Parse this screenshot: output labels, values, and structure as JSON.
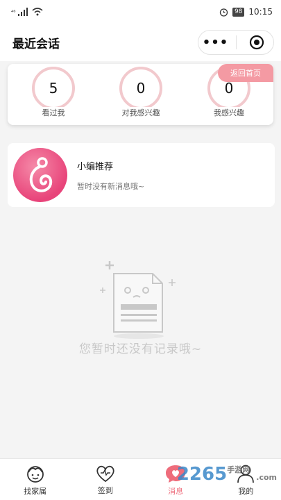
{
  "status_bar": {
    "signal_text": "⁴⁶",
    "time": "10:15",
    "battery": "98"
  },
  "nav": {
    "title": "最近会话",
    "more_icon": "more-dots-icon",
    "close_icon": "target-circle-icon"
  },
  "stats": {
    "items": [
      {
        "count": "5",
        "label": "看过我"
      },
      {
        "count": "0",
        "label": "对我感兴趣"
      },
      {
        "count": "0",
        "label": "我感兴趣"
      }
    ],
    "return_home": "返回首页",
    "ring_color": "#f2c9cd"
  },
  "recommend": {
    "name": "小编推荐",
    "message": "暂时没有新消息哦~",
    "avatar_color": "#e8447a"
  },
  "empty_state": {
    "text": "您暂时还没有记录哦~"
  },
  "tab_bar": {
    "tabs": [
      {
        "label": "找家属",
        "icon": "face-icon"
      },
      {
        "label": "签到",
        "icon": "heart-icon"
      },
      {
        "label": "消息",
        "icon": "chat-heart-icon",
        "active": true
      },
      {
        "label": "我的",
        "icon": "user-icon"
      }
    ],
    "active_color": "#ee6c7b"
  },
  "watermark": {
    "number": "2265",
    "site": "手游网",
    "domain": ".com"
  }
}
